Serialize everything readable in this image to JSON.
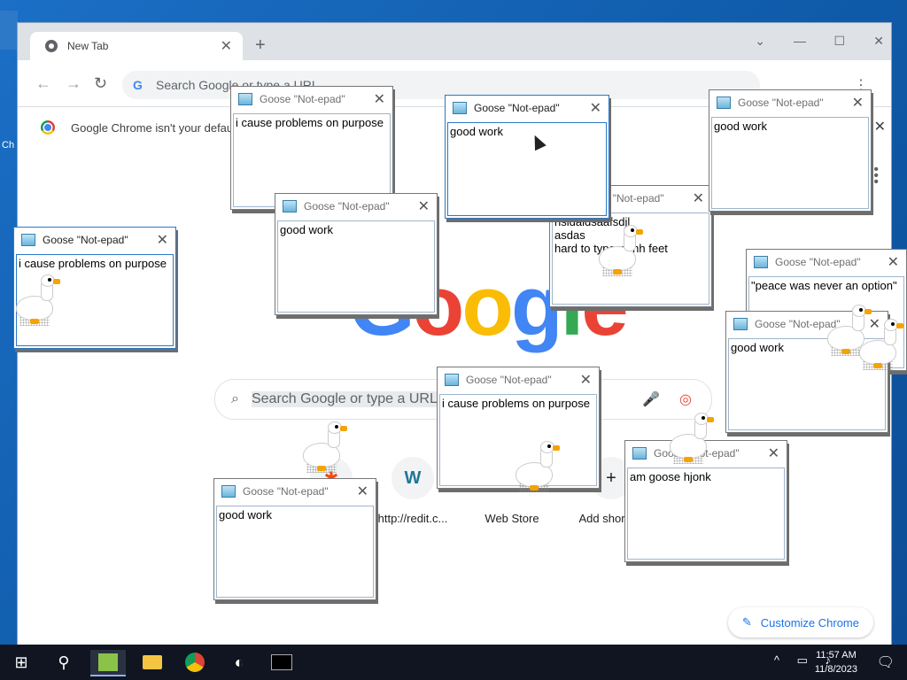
{
  "desktop": {
    "icon_label": "Ch"
  },
  "chrome": {
    "tab_title": "New Tab",
    "omnibox_placeholder": "Search Google or type a URL",
    "infobar_text": "Google Chrome isn't your default browser",
    "ntp": {
      "logo": "Google",
      "search_placeholder": "Search Google or type a URL",
      "shortcuts": [
        {
          "label": "http://redit.c..."
        },
        {
          "label": "Web Store"
        },
        {
          "label": "Add shortcut"
        }
      ],
      "customize_label": "Customize Chrome"
    }
  },
  "notepads": [
    {
      "title": "Goose \"Not-epad\"",
      "text": "i cause problems on purpose"
    },
    {
      "title": "Goose \"Not-epad\"",
      "text": "good work"
    },
    {
      "title": "Goose \"Not-epad\"",
      "text": "good work"
    },
    {
      "title": "Goose \"Not-epad\"",
      "text": "good work"
    },
    {
      "title": "Goose \"Not-epad\"",
      "text": "i cause problems on purpose"
    },
    {
      "title": "Goose \"Not-epad\"",
      "text": "hsldaldsaafsdjl\nasdas\nhard to type withh feet"
    },
    {
      "title": "Goose \"Not-epad\"",
      "text": "\"peace was never an option\""
    },
    {
      "title": "Goose \"Not-epad\"",
      "text": "good work"
    },
    {
      "title": "Goose \"Not-epad\"",
      "text": "i cause problems on purpose"
    },
    {
      "title": "Goose \"Not-epad\"",
      "text": "good work"
    },
    {
      "title": "Goose \"Not-epad\"",
      "text": "am goose hjonk"
    }
  ],
  "taskbar": {
    "time": "11:57 AM",
    "date": "11/8/2023"
  },
  "colors": {
    "google_blue": "#4285f4",
    "google_red": "#ea4335",
    "google_yellow": "#fbbc05",
    "google_green": "#34a853",
    "taskbar": "#101521"
  }
}
